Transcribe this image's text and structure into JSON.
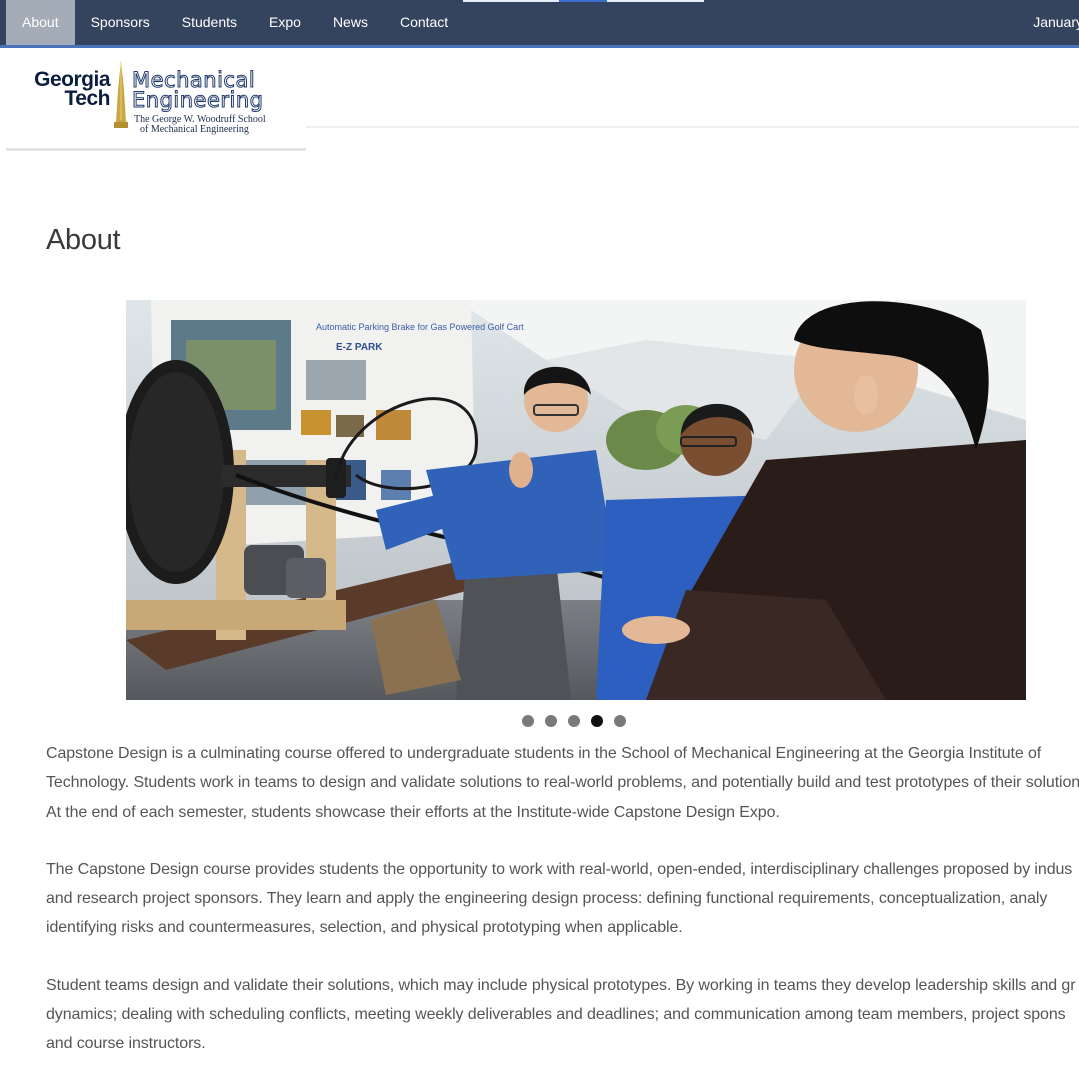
{
  "nav": {
    "items": [
      {
        "label": "About",
        "active": true
      },
      {
        "label": "Sponsors",
        "active": false
      },
      {
        "label": "Students",
        "active": false
      },
      {
        "label": "Expo",
        "active": false
      },
      {
        "label": "News",
        "active": false
      },
      {
        "label": "Contact",
        "active": false
      }
    ],
    "date_text": "January"
  },
  "logo": {
    "line1": "Georgia",
    "line2": "Tech",
    "dept1": "Mechanical",
    "dept2": "Engineering",
    "sub1": "The George W. Woodruff School",
    "sub2": "of Mechanical Engineering"
  },
  "page_title": "About",
  "carousel": {
    "slide_count": 5,
    "active_index": 3,
    "poster_label": "E-Z PARK",
    "poster_title": "Automatic Parking Brake for Gas Powered Golf Cart"
  },
  "paragraphs": [
    [
      "Capstone Design is a culminating course offered to undergraduate students in the School of Mechanical Engineering at the Georgia Institute of",
      "Technology. Students work in teams to design and validate solutions to real-world problems, and potentially build and test prototypes of their solution",
      "At the end of each semester, students showcase their efforts at the Institute-wide Capstone Design Expo."
    ],
    [
      "The Capstone Design course provides students the opportunity to work with real-world, open-ended, interdisciplinary challenges proposed by indus",
      "and research project sponsors. They learn and apply the engineering design process: defining functional requirements, conceptualization, analy",
      "identifying risks and countermeasures, selection, and physical prototyping when applicable."
    ],
    [
      "Student teams design and validate their solutions, which may include physical prototypes. By working in teams they develop leadership skills and gr",
      "dynamics; dealing with scheduling conflicts, meeting weekly deliverables and deadlines; and communication among team members, project spons",
      "and course instructors."
    ]
  ],
  "colors": {
    "nav_bg": "#34435e",
    "nav_active": "#a4acb7",
    "nav_border": "#4a72b8",
    "text": "#555555"
  }
}
